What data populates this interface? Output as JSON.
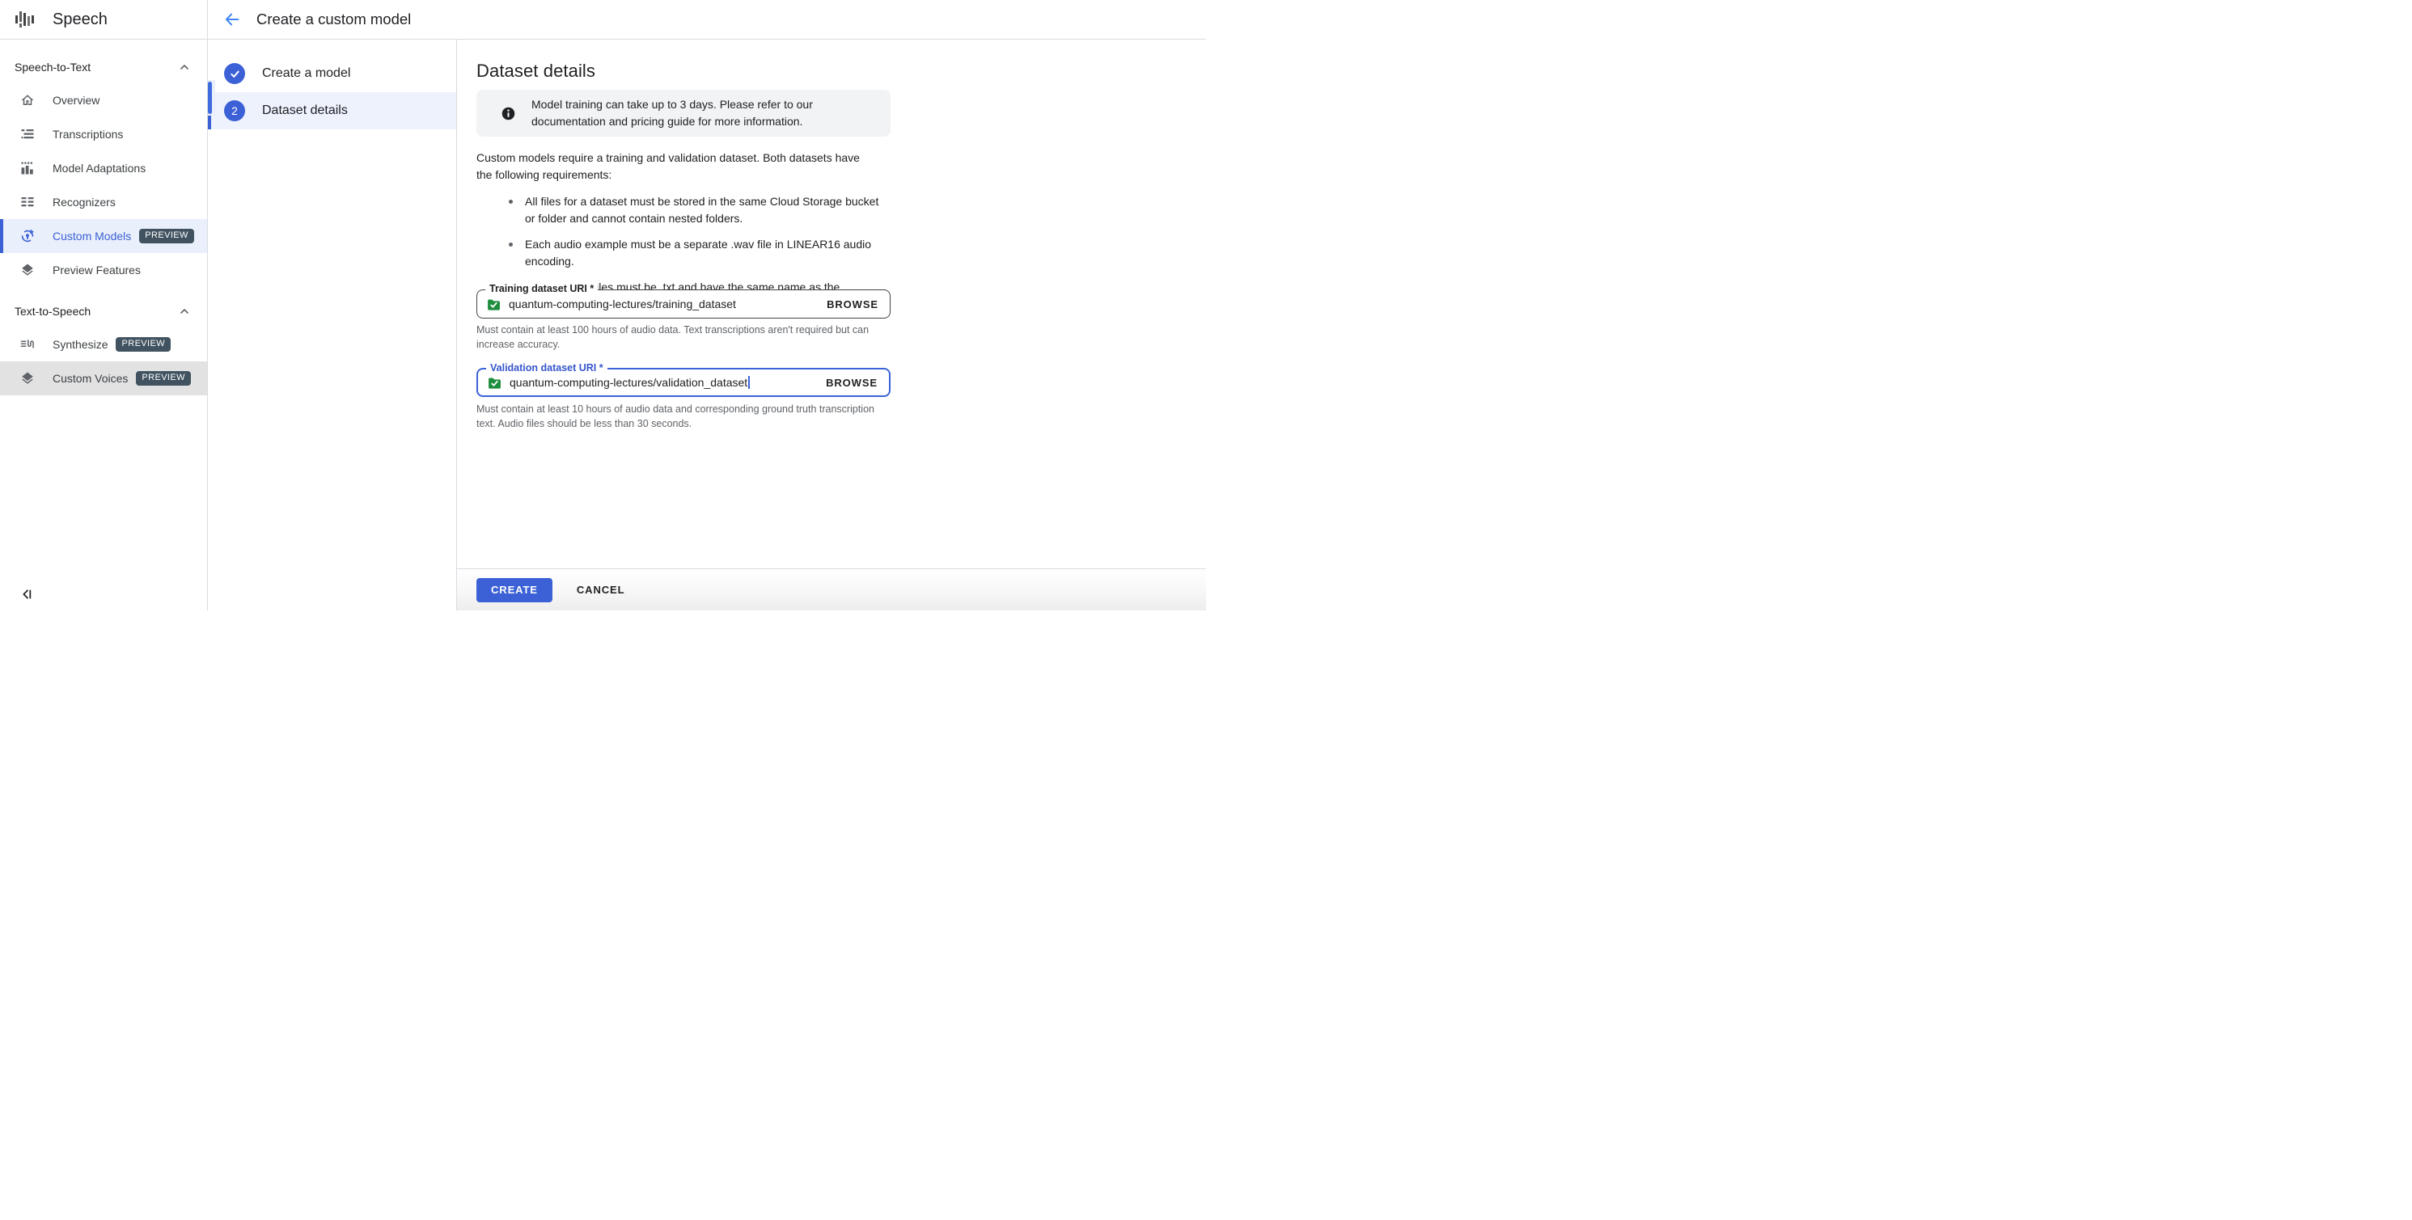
{
  "app": {
    "product_name": "Speech",
    "page_title": "Create a custom model"
  },
  "sidebar": {
    "sections": [
      {
        "label": "Speech-to-Text",
        "items": [
          {
            "label": "Overview"
          },
          {
            "label": "Transcriptions"
          },
          {
            "label": "Model Adaptations"
          },
          {
            "label": "Recognizers"
          },
          {
            "label": "Custom Models",
            "badge": "PREVIEW",
            "selected": true
          },
          {
            "label": "Preview Features"
          }
        ]
      },
      {
        "label": "Text-to-Speech",
        "items": [
          {
            "label": "Synthesize",
            "badge": "PREVIEW"
          },
          {
            "label": "Custom Voices",
            "badge": "PREVIEW"
          }
        ]
      }
    ]
  },
  "steps": [
    {
      "label": "Create a model",
      "state": "completed"
    },
    {
      "label": "Dataset details",
      "number": "2",
      "state": "active"
    }
  ],
  "main": {
    "heading": "Dataset details",
    "notice": "Model training can take up to 3 days. Please refer to our documentation and pricing guide for more information.",
    "intro": "Custom models require a training and validation dataset. Both datasets have the following requirements:",
    "requirements": [
      "All files for a dataset must be stored in the same Cloud Storage bucket or folder and cannot contain nested folders.",
      "Each audio example must be a separate .wav file in LINEAR16 audio encoding.",
      "Transcription files must be .txt and have the same name as the corresponding audio file."
    ],
    "training_field": {
      "label": "Training dataset URI *",
      "value": "quantum-computing-lectures/training_dataset",
      "browse_label": "BROWSE",
      "helper": "Must contain at least 100 hours of audio data. Text transcriptions aren't required but can increase accuracy."
    },
    "validation_field": {
      "label": "Validation dataset URI *",
      "value": "quantum-computing-lectures/validation_dataset",
      "browse_label": "BROWSE",
      "helper": "Must contain at least 10 hours of audio data and corresponding ground truth transcription text. Audio files should be less than 30 seconds."
    },
    "actions": {
      "create": "CREATE",
      "cancel": "CANCEL"
    }
  },
  "icons": {
    "logo": "waveform-bars",
    "back": "arrow-left",
    "notice": "info-filled",
    "dataset_input": "folder-check-green",
    "collapse": "collapse-sidebar-left"
  },
  "colors": {
    "primary_blue": "#3c61d6",
    "selected_nav_bg": "#e9effb",
    "active_step_bg": "#edf2fd",
    "badge_bg": "#415360",
    "notice_bg": "#f1f3f4",
    "folder_green": "#1e8e3e",
    "divider": "#dadce0",
    "helper_text": "#5f6368"
  }
}
